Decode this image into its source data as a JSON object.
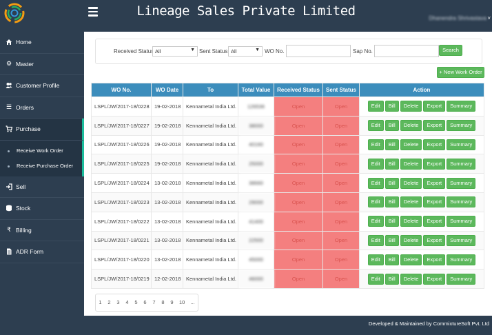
{
  "header": {
    "title": "Lineage Sales Private Limited",
    "user_name": "Dhanendra Shrivastava",
    "user_caret": "˅"
  },
  "sidebar": {
    "items": [
      {
        "label": "Home",
        "icon": "home-icon"
      },
      {
        "label": "Master",
        "icon": "gears-icon"
      },
      {
        "label": "Customer Profile",
        "icon": "users-icon"
      },
      {
        "label": "Orders",
        "icon": "list-icon"
      },
      {
        "label": "Purchase",
        "icon": "cart-icon"
      },
      {
        "label": "Sell",
        "icon": "sign-in-icon"
      },
      {
        "label": "Stock",
        "icon": "database-icon"
      },
      {
        "label": "Billing",
        "icon": "rupee-icon"
      },
      {
        "label": "ADR Form",
        "icon": "file-icon"
      }
    ],
    "purchase_sub": [
      "Receive Work Order",
      "Receive Purchase Order"
    ]
  },
  "filters": {
    "received_status_label": "Received Status:",
    "received_status_value": "All",
    "sent_status_label": "Sent Status:",
    "sent_status_value": "All",
    "wo_no_label": "WO No. :",
    "sap_no_label": "Sap No. :",
    "search_label": "Search"
  },
  "new_work_order_label": "+ New Work Order",
  "table": {
    "columns": [
      "WO No.",
      "WO Date",
      "To",
      "Total Value",
      "Received Status",
      "Sent Status",
      "Action"
    ],
    "actions": [
      "Edit",
      "Bill",
      "Delete",
      "Export",
      "Summary"
    ],
    "rows": [
      {
        "wo": "LSPL/JW/2017-18/0228",
        "date": "19-02-2018",
        "to": "Kennametal India Ltd.",
        "value": "126536",
        "received": "Open",
        "sent": "Open"
      },
      {
        "wo": "LSPL/JW/2017-18/0227",
        "date": "19-02-2018",
        "to": "Kennametal India Ltd.",
        "value": "38000",
        "received": "Open",
        "sent": "Open"
      },
      {
        "wo": "LSPL/JW/2017-18/0226",
        "date": "19-02-2018",
        "to": "Kennametal India Ltd.",
        "value": "40160",
        "received": "Open",
        "sent": "Open"
      },
      {
        "wo": "LSPL/JW/2017-18/0225",
        "date": "19-02-2018",
        "to": "Kennametal India Ltd.",
        "value": "25000",
        "received": "Open",
        "sent": "Open"
      },
      {
        "wo": "LSPL/JW/2017-18/0224",
        "date": "13-02-2018",
        "to": "Kennametal India Ltd.",
        "value": "38660",
        "received": "Open",
        "sent": "Open"
      },
      {
        "wo": "LSPL/JW/2017-18/0223",
        "date": "13-02-2018",
        "to": "Kennametal India Ltd.",
        "value": "29000",
        "received": "Open",
        "sent": "Open"
      },
      {
        "wo": "LSPL/JW/2017-18/0222",
        "date": "13-02-2018",
        "to": "Kennametal India Ltd.",
        "value": "41400",
        "received": "Open",
        "sent": "Open"
      },
      {
        "wo": "LSPL/JW/2017-18/0221",
        "date": "13-02-2018",
        "to": "Kennametal India Ltd.",
        "value": "22500",
        "received": "Open",
        "sent": "Open"
      },
      {
        "wo": "LSPL/JW/2017-18/0220",
        "date": "13-02-2018",
        "to": "Kennametal India Ltd.",
        "value": "45000",
        "received": "Open",
        "sent": "Open"
      },
      {
        "wo": "LSPL/JW/2017-18/0219",
        "date": "12-02-2018",
        "to": "Kennametal India Ltd.",
        "value": "46000",
        "received": "Open",
        "sent": "Open"
      }
    ]
  },
  "pagination": [
    "1",
    "2",
    "3",
    "4",
    "5",
    "6",
    "7",
    "8",
    "9",
    "10",
    "..."
  ],
  "footer": "Developed & Maintained by CommixtureSoft Pvt. Ltd",
  "colors": {
    "accent": "#1abc9c",
    "header_bg": "#2d3e50",
    "table_head": "#3c8dbc",
    "button": "#5cb85c",
    "status_open": "#f47f7f"
  }
}
